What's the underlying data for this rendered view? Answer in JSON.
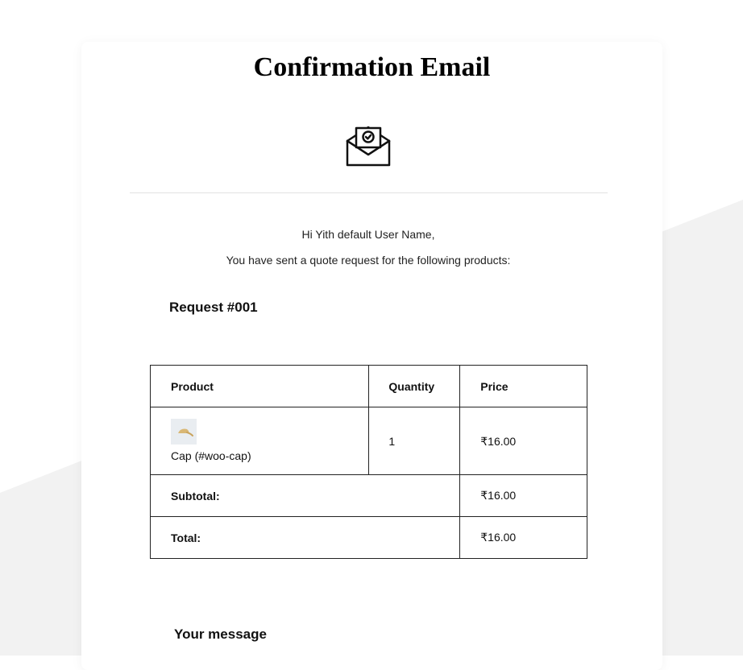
{
  "email": {
    "title": "Confirmation Email",
    "icon": "envelope-check-icon",
    "greeting": "Hi Yith default User Name,",
    "intro": "You have sent a quote request for the following products:",
    "request_heading": "Request #001",
    "message_heading": "Your message"
  },
  "table": {
    "headers": {
      "product": "Product",
      "quantity": "Quantity",
      "price": "Price"
    },
    "items": [
      {
        "thumbnail_icon": "cap-thumbnail-icon",
        "name": "Cap (#woo-cap)",
        "quantity": "1",
        "price": "₹16.00"
      }
    ],
    "subtotal_label": "Subtotal:",
    "subtotal_value": "₹16.00",
    "total_label": "Total:",
    "total_value": "₹16.00"
  },
  "colors": {
    "background": "#ffffff",
    "background_shape": "#f2f2f2",
    "card": "#ffffff",
    "border": "#222222",
    "divider": "#e2e2e2"
  }
}
